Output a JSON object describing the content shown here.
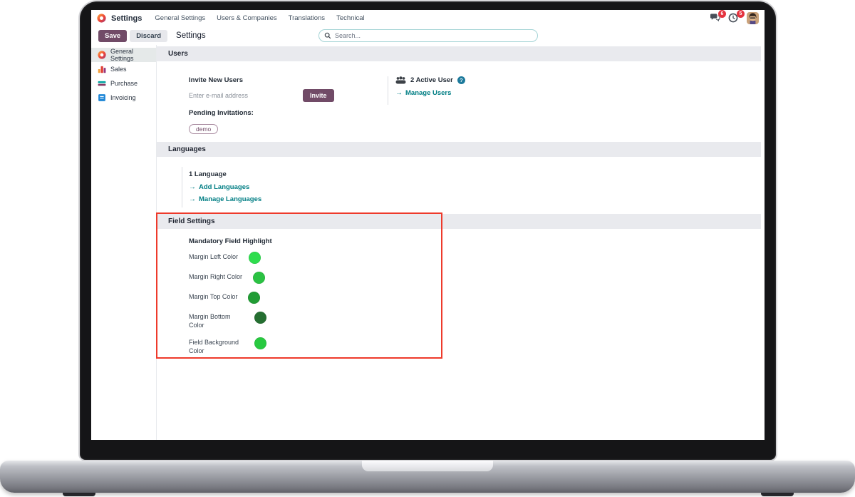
{
  "navbar": {
    "app_name": "Settings",
    "menu_items": [
      "General Settings",
      "Users & Companies",
      "Translations",
      "Technical"
    ],
    "messages_badge": "6",
    "activities_badge": "5"
  },
  "control_panel": {
    "save_label": "Save",
    "discard_label": "Discard",
    "breadcrumb": "Settings",
    "search_placeholder": "Search..."
  },
  "sidebar": {
    "items": [
      {
        "label": "General Settings",
        "icon": "odoo",
        "selected": true
      },
      {
        "label": "Sales",
        "icon": "sales",
        "selected": false
      },
      {
        "label": "Purchase",
        "icon": "purchase",
        "selected": false
      },
      {
        "label": "Invoicing",
        "icon": "invoicing",
        "selected": false
      }
    ]
  },
  "sections": {
    "users": {
      "header": "Users",
      "invite_title": "Invite New Users",
      "email_placeholder": "Enter e-mail address",
      "invite_button": "Invite",
      "pending_label": "Pending Invitations:",
      "pending_tags": [
        "demo"
      ],
      "active_user_text": "2 Active User",
      "manage_users_link": "Manage Users"
    },
    "languages": {
      "header": "Languages",
      "count_text": "1 Language",
      "add_link": "Add Languages",
      "manage_link": "Manage Languages"
    },
    "field_settings": {
      "header": "Field Settings",
      "group_title": "Mandatory Field Highlight",
      "fields": [
        {
          "label": "Margin Left Color",
          "color": "#2edd4e"
        },
        {
          "label": "Margin Right Color",
          "color": "#2bc243"
        },
        {
          "label": "Margin Top Color",
          "color": "#219c35"
        },
        {
          "label": "Margin Bottom Color",
          "color": "#256f31"
        },
        {
          "label": "Field Background Color",
          "color": "#28c940"
        }
      ]
    }
  },
  "colors": {
    "primary": "#714B67",
    "link": "#017e84",
    "highlight_border": "#ee3a2b",
    "badge": "#e5333f"
  }
}
